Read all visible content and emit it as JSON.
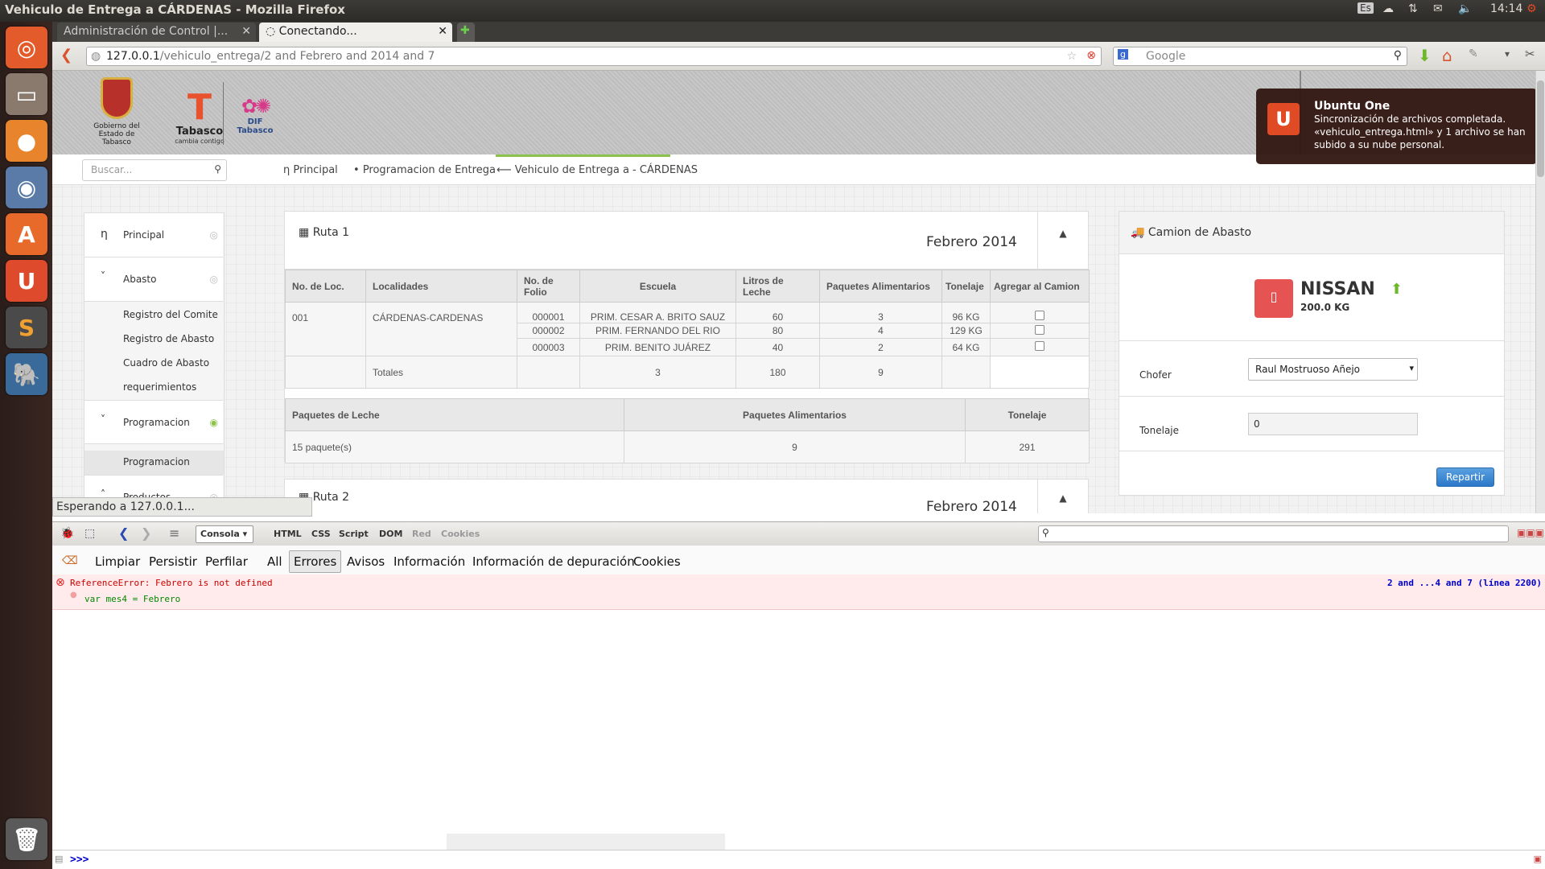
{
  "window": {
    "title": "Vehiculo de Entrega a CÁRDENAS - Mozilla Firefox",
    "time": "14:14",
    "keyboard": "Es"
  },
  "tabs": [
    {
      "label": "Administración de Control |..."
    },
    {
      "label": "Conectando..."
    }
  ],
  "url": {
    "host": "127.0.0.1",
    "path": "/vehiculo_entrega/2 and Febrero and 2014 and 7"
  },
  "search": {
    "placeholder": "Google"
  },
  "site": {
    "logo1": "Gobierno del Estado de Tabasco",
    "logo2": "Tabasco",
    "logo2_sub": "cambia contigo",
    "logo3": "DIF Tabasco",
    "search_placeholder": "Buscar..."
  },
  "breadcrumb": [
    "Principal",
    "Programacion de Entrega",
    "Vehiculo de Entrega a - CÁRDENAS"
  ],
  "sidebar": {
    "principal": "Principal",
    "abasto": "Abasto",
    "abasto_items": [
      "Registro del Comite",
      "Registro de Abasto",
      "Cuadro de Abasto",
      "requerimientos"
    ],
    "programacion": "Programacion",
    "programacion_items": [
      "Programacion"
    ],
    "productos": "Productos"
  },
  "ruta1": {
    "title": "Ruta 1",
    "date": "Febrero 2014",
    "headers": [
      "No. de Loc.",
      "Localidades",
      "No. de Folio",
      "Escuela",
      "Litros de Leche",
      "Paquetes Alimentarios",
      "Tonelaje",
      "Agregar al Camion"
    ],
    "loc": "001",
    "localidad": "CÁRDENAS-CARDENAS",
    "rows": [
      {
        "folio": "000001",
        "escuela": "PRIM. CESAR A. BRITO SAUZ",
        "litros": "60",
        "paquetes": "3",
        "tonelaje": "96 KG"
      },
      {
        "folio": "000002",
        "escuela": "PRIM. FERNANDO DEL RIO",
        "litros": "80",
        "paquetes": "4",
        "tonelaje": "129 KG"
      },
      {
        "folio": "000003",
        "escuela": "PRIM. BENITO JUÁREZ",
        "litros": "40",
        "paquetes": "2",
        "tonelaje": "64 KG"
      }
    ],
    "totales_label": "Totales",
    "tot_escuelas": "3",
    "tot_litros": "180",
    "tot_paquetes": "9",
    "summary_headers": [
      "Paquetes de Leche",
      "Paquetes Alimentarios",
      "Tonelaje"
    ],
    "summary": [
      "15 paquete(s)",
      "9",
      "291"
    ]
  },
  "ruta2": {
    "title": "Ruta 2",
    "date": "Febrero 2014"
  },
  "camion": {
    "title": "Camion de Abasto",
    "brand": "NISSAN",
    "capacity": "200.0 KG",
    "chofer_label": "Chofer",
    "chofer_value": "Raul Mostruoso Añejo",
    "tonelaje_label": "Tonelaje",
    "tonelaje_value": "0",
    "button": "Repartir"
  },
  "notification": {
    "title": "Ubuntu One",
    "body": "Sincronización de archivos completada. «vehiculo_entrega.html» y 1 archivo se han subido a su nube personal."
  },
  "status": "Esperando a 127.0.0.1...",
  "devtools": {
    "tabs": [
      "Consola",
      "HTML",
      "CSS",
      "Script",
      "DOM",
      "Red",
      "Cookies"
    ],
    "buttons": [
      "Limpiar",
      "Persistir",
      "Perfilar"
    ],
    "filters": [
      "All",
      "Errores",
      "Avisos",
      "Información",
      "Información de depuración",
      "Cookies"
    ],
    "error": "ReferenceError: Febrero is not defined",
    "error_location": "2 and ...4 and 7 (línea 2200)",
    "error_code": "var mes4 = Febrero",
    "prompt": ">>>"
  }
}
